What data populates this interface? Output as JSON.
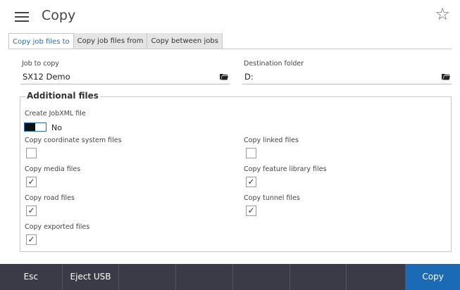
{
  "header": {
    "title": "Copy",
    "menu_icon": "hamburger-icon",
    "favorite_icon": "star-icon"
  },
  "tabs": [
    {
      "label": "Copy job files to",
      "active": true
    },
    {
      "label": "Copy job files from",
      "active": false
    },
    {
      "label": "Copy between jobs",
      "active": false
    }
  ],
  "job": {
    "label": "Job to copy",
    "value": "SX12 Demo"
  },
  "destination": {
    "label": "Destination folder",
    "value": "D:"
  },
  "additional": {
    "title": "Additional files",
    "jobxml_label": "Create JobXML file",
    "jobxml_value": "No",
    "items": [
      {
        "label": "Copy coordinate system files",
        "checked": false
      },
      {
        "label": "Copy linked files",
        "checked": false
      },
      {
        "label": "Copy media files",
        "checked": true
      },
      {
        "label": "Copy feature library files",
        "checked": true
      },
      {
        "label": "Copy road files",
        "checked": true
      },
      {
        "label": "Copy tunnel files",
        "checked": true
      },
      {
        "label": "Copy exported files",
        "checked": true
      }
    ]
  },
  "bottom_bar": {
    "esc": "Esc",
    "eject": "Eject USB",
    "copy": "Copy"
  },
  "colors": {
    "accent": "#1b6ab5",
    "bar": "#3b3b47",
    "tab_active_text": "#2a6fb5"
  }
}
